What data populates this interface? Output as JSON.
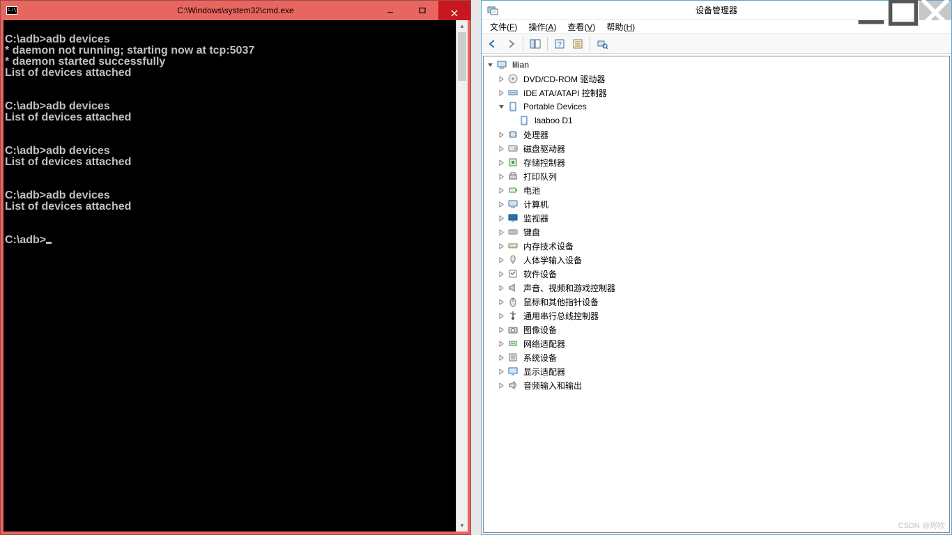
{
  "cmd": {
    "title": "C:\\Windows\\system32\\cmd.exe",
    "output": "\nC:\\adb>adb devices\n* daemon not running; starting now at tcp:5037\n* daemon started successfully\nList of devices attached\n\n\nC:\\adb>adb devices\nList of devices attached\n\n\nC:\\adb>adb devices\nList of devices attached\n\n\nC:\\adb>adb devices\nList of devices attached\n\n\n",
    "prompt": "C:\\adb>"
  },
  "dm": {
    "title": "设备管理器",
    "menu": [
      {
        "label": "文件",
        "key": "F"
      },
      {
        "label": "操作",
        "key": "A"
      },
      {
        "label": "查看",
        "key": "V"
      },
      {
        "label": "帮助",
        "key": "H"
      }
    ],
    "tree": [
      {
        "level": 0,
        "exp": "open",
        "icon": "computer",
        "label": "lilian",
        "name": "tree-root-computer"
      },
      {
        "level": 1,
        "exp": "closed",
        "icon": "disc",
        "label": "DVD/CD-ROM 驱动器",
        "name": "tree-dvd-cdrom"
      },
      {
        "level": 1,
        "exp": "closed",
        "icon": "ide",
        "label": "IDE ATA/ATAPI 控制器",
        "name": "tree-ide-atapi"
      },
      {
        "level": 1,
        "exp": "open",
        "icon": "portable",
        "label": "Portable Devices",
        "name": "tree-portable-devices"
      },
      {
        "level": 2,
        "exp": "none",
        "icon": "portable",
        "label": "laaboo D1",
        "name": "tree-device-laaboo-d1"
      },
      {
        "level": 1,
        "exp": "closed",
        "icon": "cpu",
        "label": "处理器",
        "name": "tree-processors"
      },
      {
        "level": 1,
        "exp": "closed",
        "icon": "disk",
        "label": "磁盘驱动器",
        "name": "tree-disk-drives"
      },
      {
        "level": 1,
        "exp": "closed",
        "icon": "storage",
        "label": "存储控制器",
        "name": "tree-storage-controllers"
      },
      {
        "level": 1,
        "exp": "closed",
        "icon": "printer",
        "label": "打印队列",
        "name": "tree-print-queues"
      },
      {
        "level": 1,
        "exp": "closed",
        "icon": "battery",
        "label": "电池",
        "name": "tree-batteries"
      },
      {
        "level": 1,
        "exp": "closed",
        "icon": "computer",
        "label": "计算机",
        "name": "tree-computer-category"
      },
      {
        "level": 1,
        "exp": "closed",
        "icon": "monitor",
        "label": "监视器",
        "name": "tree-monitors"
      },
      {
        "level": 1,
        "exp": "closed",
        "icon": "keyboard",
        "label": "键盘",
        "name": "tree-keyboards"
      },
      {
        "level": 1,
        "exp": "closed",
        "icon": "memory",
        "label": "内存技术设备",
        "name": "tree-memory-tech"
      },
      {
        "level": 1,
        "exp": "closed",
        "icon": "hid",
        "label": "人体学输入设备",
        "name": "tree-hid"
      },
      {
        "level": 1,
        "exp": "closed",
        "icon": "software",
        "label": "软件设备",
        "name": "tree-software-devices"
      },
      {
        "level": 1,
        "exp": "closed",
        "icon": "audio",
        "label": "声音、视频和游戏控制器",
        "name": "tree-sound-video-game"
      },
      {
        "level": 1,
        "exp": "closed",
        "icon": "mouse",
        "label": "鼠标和其他指针设备",
        "name": "tree-mice-pointing"
      },
      {
        "level": 1,
        "exp": "closed",
        "icon": "usb",
        "label": "通用串行总线控制器",
        "name": "tree-usb-controllers"
      },
      {
        "level": 1,
        "exp": "closed",
        "icon": "imaging",
        "label": "图像设备",
        "name": "tree-imaging-devices"
      },
      {
        "level": 1,
        "exp": "closed",
        "icon": "network",
        "label": "网络适配器",
        "name": "tree-network-adapters"
      },
      {
        "level": 1,
        "exp": "closed",
        "icon": "system",
        "label": "系统设备",
        "name": "tree-system-devices"
      },
      {
        "level": 1,
        "exp": "closed",
        "icon": "display",
        "label": "显示适配器",
        "name": "tree-display-adapters"
      },
      {
        "level": 1,
        "exp": "closed",
        "icon": "audioio",
        "label": "音频输入和输出",
        "name": "tree-audio-io"
      }
    ]
  },
  "watermark": "CSDN @烬吹"
}
